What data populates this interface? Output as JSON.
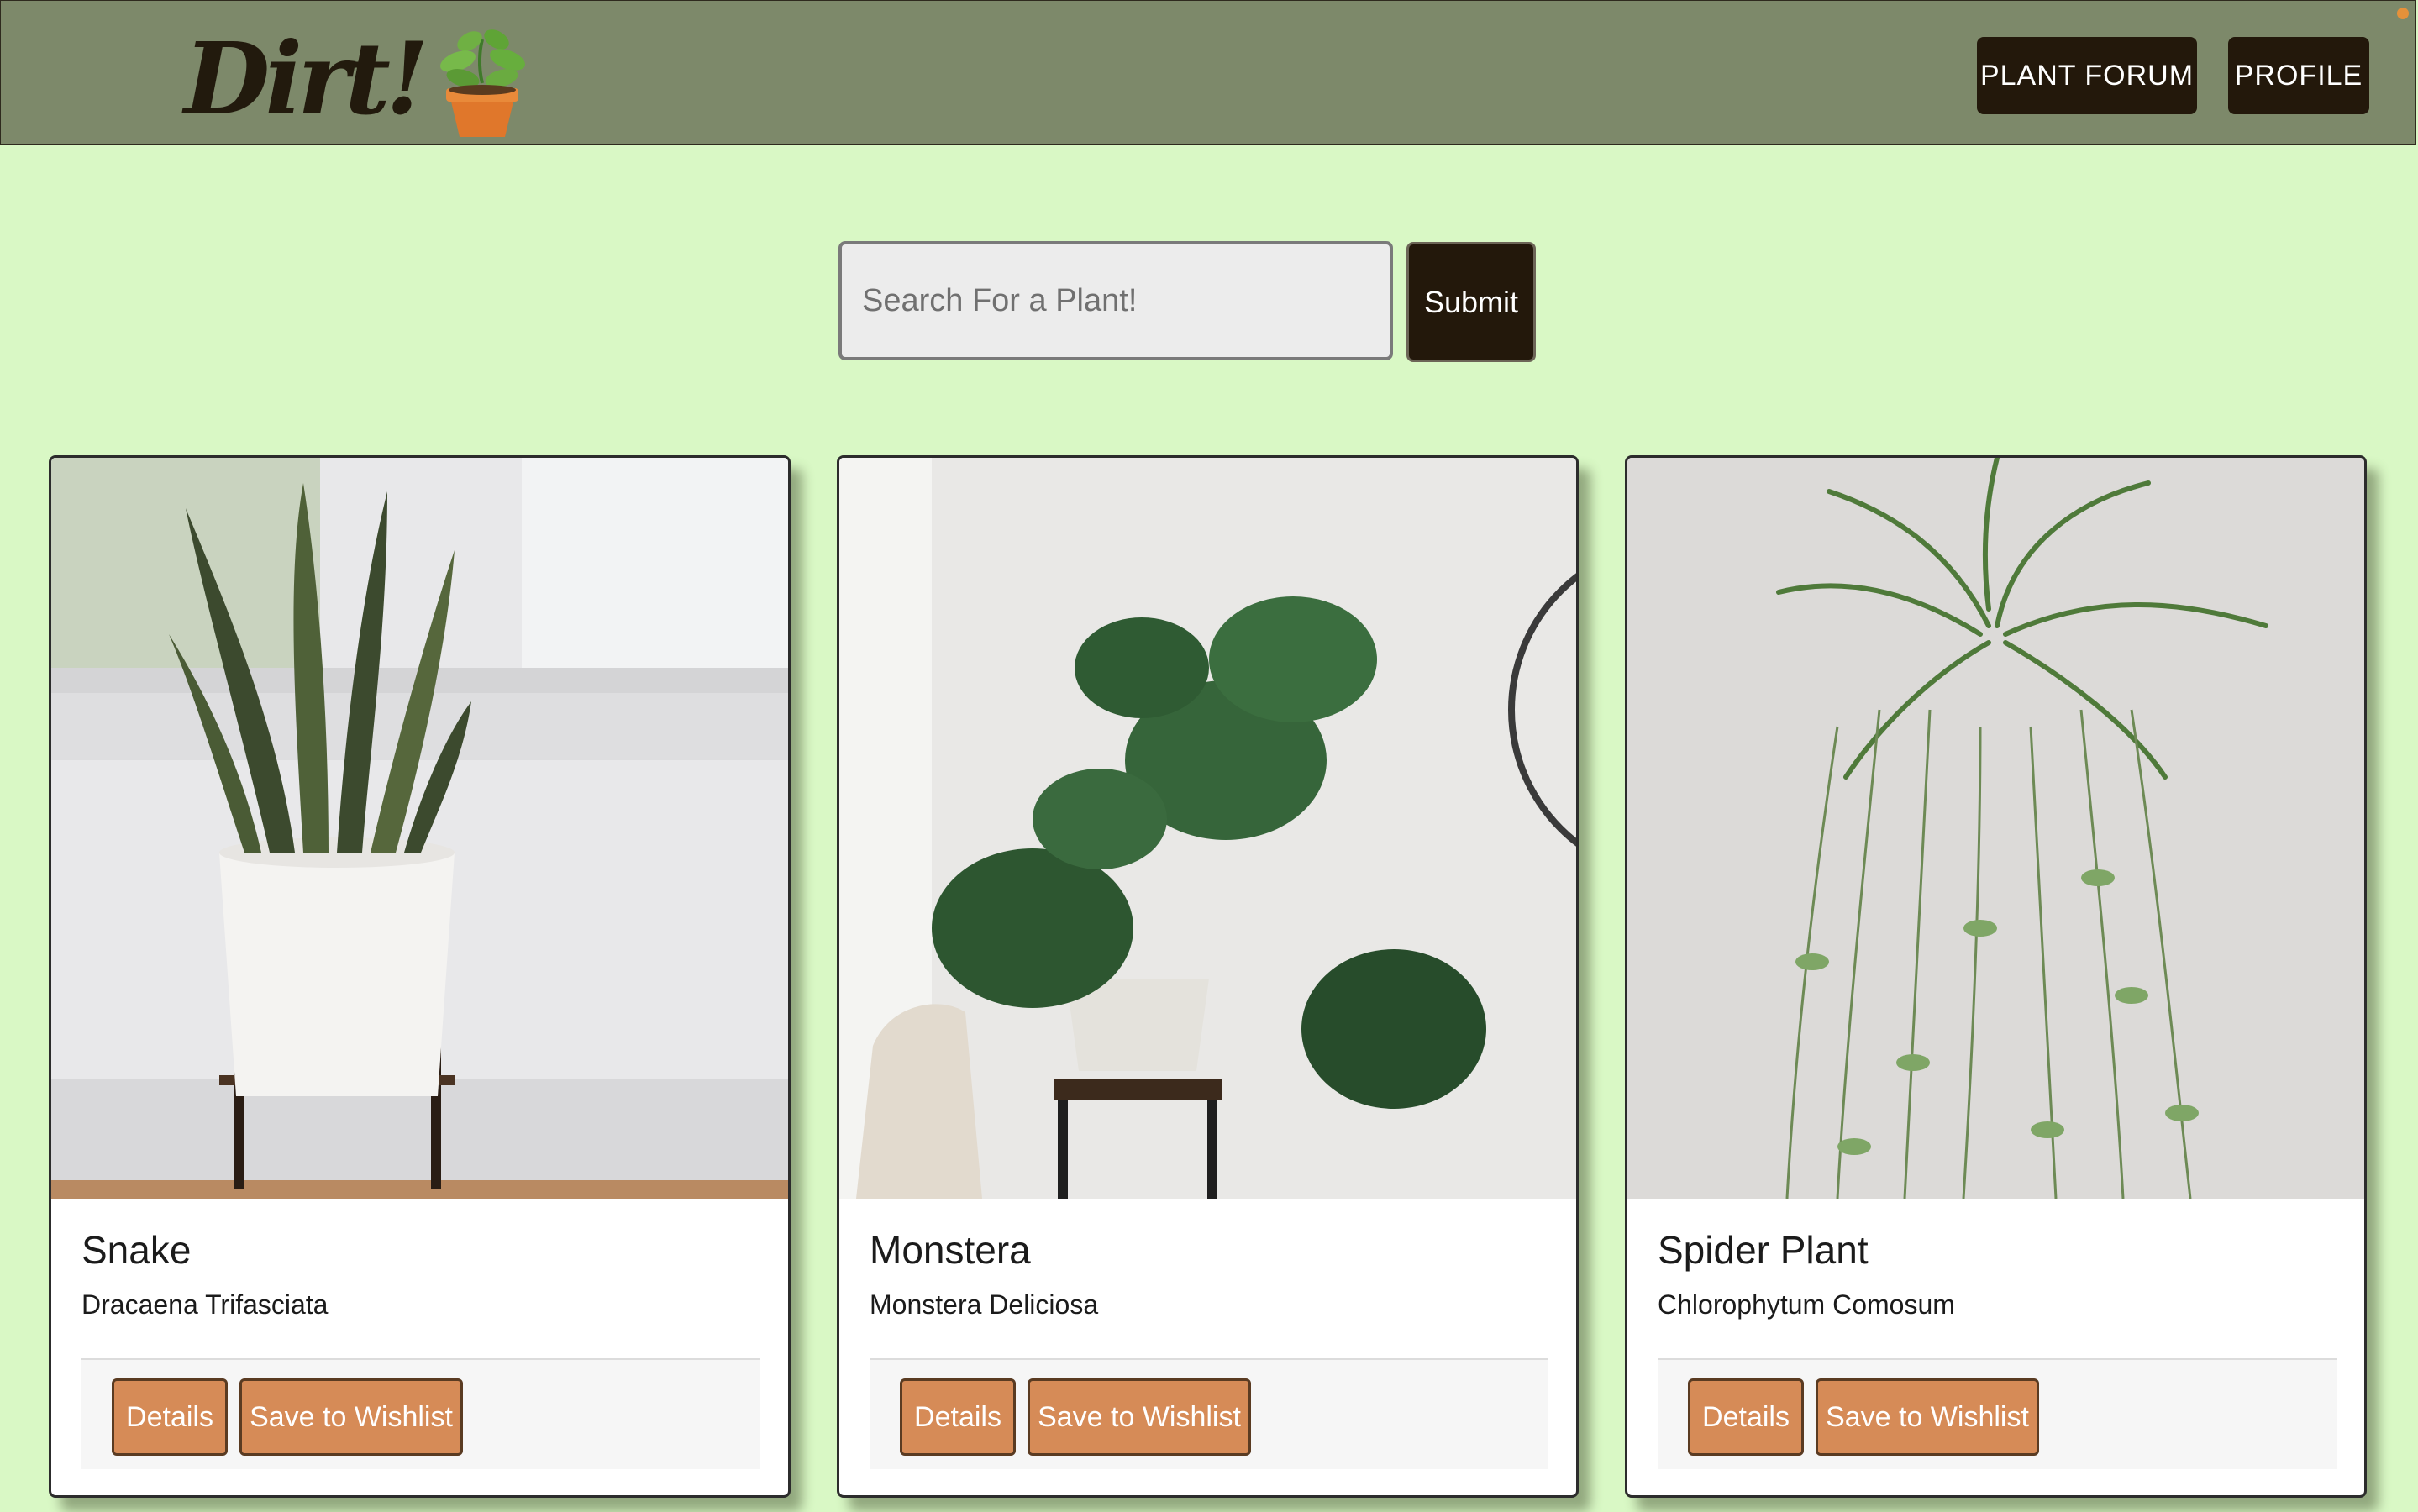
{
  "header": {
    "logo_text": "Dirt!",
    "nav": {
      "forum_label": "PLANT FORUM",
      "profile_label": "PROFILE"
    }
  },
  "search": {
    "placeholder": "Search For a Plant!",
    "value": "",
    "submit_label": "Submit"
  },
  "cards": [
    {
      "title": "Snake",
      "subtitle": "Dracaena Trifasciata",
      "details_label": "Details",
      "wishlist_label": "Save to Wishlist"
    },
    {
      "title": "Monstera",
      "subtitle": "Monstera Deliciosa",
      "details_label": "Details",
      "wishlist_label": "Save to Wishlist"
    },
    {
      "title": "Spider Plant",
      "subtitle": "Chlorophytum Comosum",
      "details_label": "Details",
      "wishlist_label": "Save to Wishlist"
    }
  ],
  "colors": {
    "page_background": "#d9f8c5",
    "header_background": "#7d896a",
    "dark_button": "#23180b",
    "accent_button": "#d68b57"
  },
  "icons": [
    "potted-plant-icon"
  ]
}
